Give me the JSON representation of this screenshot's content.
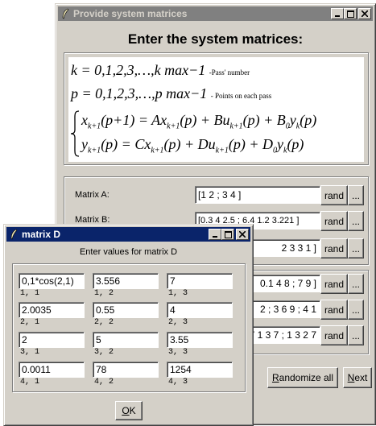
{
  "main_window": {
    "title": "Provide system matrices",
    "heading": "Enter the system matrices:",
    "equations": {
      "line1": "k = 0,1,2,3,…,k max−1",
      "line1_note": "-Pass' number",
      "line2": "p = 0,1,2,3,…,p max−1",
      "line2_note": "- Points on each pass",
      "line3": "x k+1 (p+1) = Ax k+1 (p) + Bu k+1 (p) + B0 y k (p)",
      "line4": "y k+1 (p) = Cx k+1 (p) + Du k+1 (p) + D0 y k (p)"
    },
    "matrices": [
      {
        "label": "Matrix A:",
        "value": "[1 2 ; 3 4 ]"
      },
      {
        "label": "Matrix B:",
        "value": "[0.3 4 2.5 ; 6.4 1.2 3.221 ]"
      },
      {
        "label": "",
        "value": "2 3 3 1 ]"
      },
      {
        "label": "",
        "value": "0.1 4 8 ; 7 9 ]"
      },
      {
        "label": "",
        "value": "2 ; 3 6 9 ; 4 1"
      },
      {
        "label": "",
        "value": "7 1 3 7 ; 1 3 2 7"
      }
    ],
    "rand_label": "rand",
    "more_label": "...",
    "randomize_all": "Randomize all",
    "randomize_all_accel": "R",
    "next": "Next",
    "next_accel": "N"
  },
  "dialog": {
    "title": "matrix D",
    "subtitle": "Enter values for matrix D",
    "cells": [
      {
        "value": "0,1*cos(2,1)",
        "index": "1, 1"
      },
      {
        "value": "3.556",
        "index": "1, 2"
      },
      {
        "value": "7",
        "index": "1, 3"
      },
      {
        "value": "2.0035",
        "index": "2, 1"
      },
      {
        "value": "0.55",
        "index": "2, 2"
      },
      {
        "value": "4",
        "index": "2, 3"
      },
      {
        "value": "2",
        "index": "3, 1"
      },
      {
        "value": "5",
        "index": "3, 2"
      },
      {
        "value": "3.55",
        "index": "3, 3"
      },
      {
        "value": "0.0011",
        "index": "4, 1"
      },
      {
        "value": "78",
        "index": "4, 2"
      },
      {
        "value": "1254",
        "index": "4, 3"
      }
    ],
    "ok": "OK",
    "ok_accel": "O"
  }
}
